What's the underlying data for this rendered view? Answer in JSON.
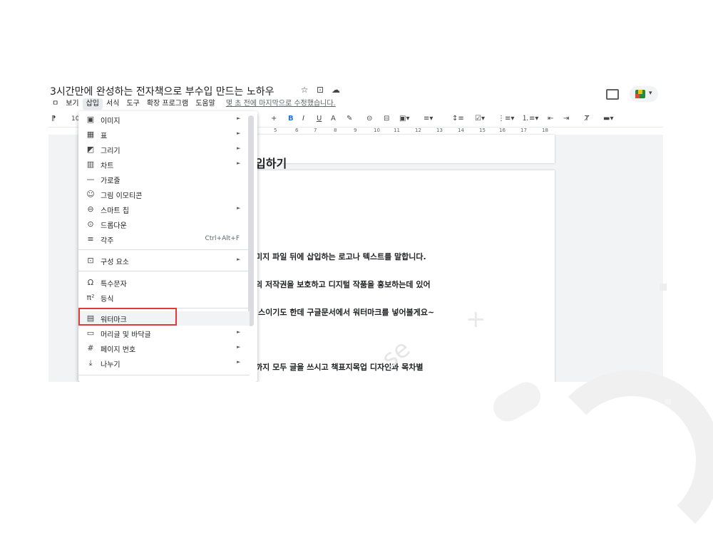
{
  "doc_title": "3시간만에 완성하는 전자책으로 부수입 만드는 노하우",
  "title_icons": [
    "☆",
    "⊡",
    "☁"
  ],
  "menubar": {
    "items": [
      "ຈ",
      "보기",
      "삽입",
      "서식",
      "도구",
      "확장 프로그램",
      "도움말"
    ],
    "saved": "몇 초 전에 마지막으로 수정했습니다."
  },
  "toolbar": {
    "font_size_partial": "10",
    "bold": "B",
    "italic": "I",
    "underline": "U",
    "plus": "+"
  },
  "ruler": [
    "5",
    "6",
    "7",
    "8",
    "9",
    "10",
    "11",
    "12",
    "13",
    "14",
    "15",
    "16",
    "17",
    "18"
  ],
  "doc": {
    "heading": "입하기",
    "lines": [
      "미지 파일 뒤에 삽입하는 로고나 텍스트를 말합니다.",
      "의 저작권을 보호하고 디지털 작품을 홍보하는데 있어",
      "|스이기도 한데 구글문서에서 워터마크를 넣어볼게요~",
      "까지 모두 글을 쓰시고 책표지목업 디자인과 목차별"
    ]
  },
  "insert_menu": [
    {
      "icon": "image-icon",
      "glyph": "▣",
      "label": "이미지",
      "submenu": true
    },
    {
      "icon": "table-icon",
      "glyph": "▦",
      "label": "표",
      "submenu": true
    },
    {
      "icon": "drawing-icon",
      "glyph": "◩",
      "label": "그리기",
      "submenu": true
    },
    {
      "icon": "chart-icon",
      "glyph": "▥",
      "label": "차트",
      "submenu": true
    },
    {
      "icon": "horizontal-line-icon",
      "glyph": "—",
      "label": "가로줄",
      "submenu": false
    },
    {
      "icon": "emoji-icon",
      "glyph": "☺",
      "label": "그림 이모티콘",
      "submenu": false
    },
    {
      "icon": "smart-chip-icon",
      "glyph": "⊖",
      "label": "스마트 칩",
      "submenu": true
    },
    {
      "icon": "dropdown-icon",
      "glyph": "⊙",
      "label": "드롭다운",
      "submenu": false
    },
    {
      "icon": "footnote-icon",
      "glyph": "≡",
      "label": "각주",
      "submenu": false,
      "shortcut": "Ctrl+Alt+F"
    },
    {
      "icon": "building-blocks-icon",
      "glyph": "⊡",
      "label": "구성 요소",
      "submenu": true
    },
    {
      "icon": "special-chars-icon",
      "glyph": "Ω",
      "label": "특수문자",
      "submenu": false
    },
    {
      "icon": "equation-icon",
      "glyph": "π²",
      "label": "등식",
      "submenu": false
    },
    {
      "icon": "watermark-icon",
      "glyph": "▤",
      "label": "워터마크",
      "submenu": false
    },
    {
      "icon": "header-footer-icon",
      "glyph": "▭",
      "label": "머리글 및 바닥글",
      "submenu": true
    },
    {
      "icon": "page-number-icon",
      "glyph": "#",
      "label": "페이지 번호",
      "submenu": true
    },
    {
      "icon": "break-icon",
      "glyph": "⤓",
      "label": "나누기",
      "submenu": true
    }
  ],
  "submenu_arrow": "►",
  "watermark_text": "se",
  "watermark_plus": "+",
  "colors": {
    "highlight": "#e03a3a",
    "accent": "#1a73e8"
  }
}
